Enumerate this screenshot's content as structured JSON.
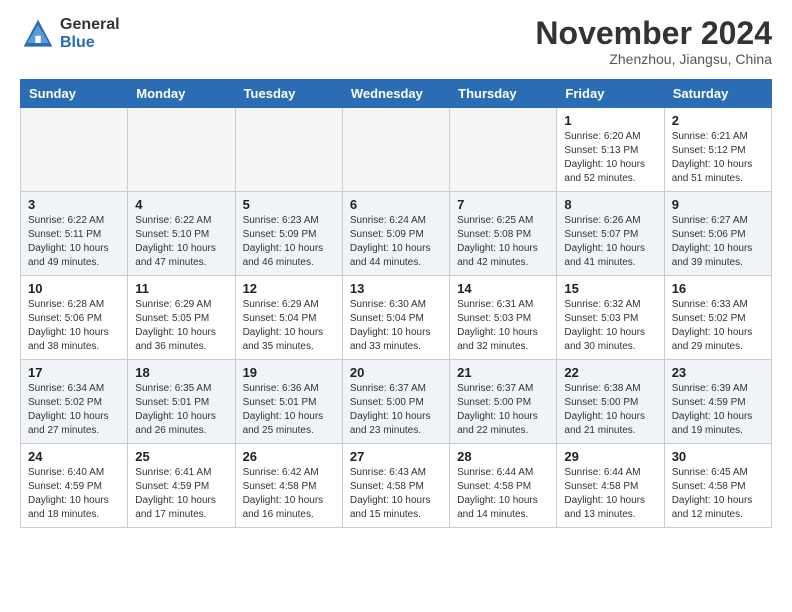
{
  "logo": {
    "general": "General",
    "blue": "Blue"
  },
  "header": {
    "month": "November 2024",
    "location": "Zhenzhou, Jiangsu, China"
  },
  "weekdays": [
    "Sunday",
    "Monday",
    "Tuesday",
    "Wednesday",
    "Thursday",
    "Friday",
    "Saturday"
  ],
  "weeks": [
    [
      {
        "day": "",
        "info": ""
      },
      {
        "day": "",
        "info": ""
      },
      {
        "day": "",
        "info": ""
      },
      {
        "day": "",
        "info": ""
      },
      {
        "day": "",
        "info": ""
      },
      {
        "day": "1",
        "info": "Sunrise: 6:20 AM\nSunset: 5:13 PM\nDaylight: 10 hours\nand 52 minutes."
      },
      {
        "day": "2",
        "info": "Sunrise: 6:21 AM\nSunset: 5:12 PM\nDaylight: 10 hours\nand 51 minutes."
      }
    ],
    [
      {
        "day": "3",
        "info": "Sunrise: 6:22 AM\nSunset: 5:11 PM\nDaylight: 10 hours\nand 49 minutes."
      },
      {
        "day": "4",
        "info": "Sunrise: 6:22 AM\nSunset: 5:10 PM\nDaylight: 10 hours\nand 47 minutes."
      },
      {
        "day": "5",
        "info": "Sunrise: 6:23 AM\nSunset: 5:09 PM\nDaylight: 10 hours\nand 46 minutes."
      },
      {
        "day": "6",
        "info": "Sunrise: 6:24 AM\nSunset: 5:09 PM\nDaylight: 10 hours\nand 44 minutes."
      },
      {
        "day": "7",
        "info": "Sunrise: 6:25 AM\nSunset: 5:08 PM\nDaylight: 10 hours\nand 42 minutes."
      },
      {
        "day": "8",
        "info": "Sunrise: 6:26 AM\nSunset: 5:07 PM\nDaylight: 10 hours\nand 41 minutes."
      },
      {
        "day": "9",
        "info": "Sunrise: 6:27 AM\nSunset: 5:06 PM\nDaylight: 10 hours\nand 39 minutes."
      }
    ],
    [
      {
        "day": "10",
        "info": "Sunrise: 6:28 AM\nSunset: 5:06 PM\nDaylight: 10 hours\nand 38 minutes."
      },
      {
        "day": "11",
        "info": "Sunrise: 6:29 AM\nSunset: 5:05 PM\nDaylight: 10 hours\nand 36 minutes."
      },
      {
        "day": "12",
        "info": "Sunrise: 6:29 AM\nSunset: 5:04 PM\nDaylight: 10 hours\nand 35 minutes."
      },
      {
        "day": "13",
        "info": "Sunrise: 6:30 AM\nSunset: 5:04 PM\nDaylight: 10 hours\nand 33 minutes."
      },
      {
        "day": "14",
        "info": "Sunrise: 6:31 AM\nSunset: 5:03 PM\nDaylight: 10 hours\nand 32 minutes."
      },
      {
        "day": "15",
        "info": "Sunrise: 6:32 AM\nSunset: 5:03 PM\nDaylight: 10 hours\nand 30 minutes."
      },
      {
        "day": "16",
        "info": "Sunrise: 6:33 AM\nSunset: 5:02 PM\nDaylight: 10 hours\nand 29 minutes."
      }
    ],
    [
      {
        "day": "17",
        "info": "Sunrise: 6:34 AM\nSunset: 5:02 PM\nDaylight: 10 hours\nand 27 minutes."
      },
      {
        "day": "18",
        "info": "Sunrise: 6:35 AM\nSunset: 5:01 PM\nDaylight: 10 hours\nand 26 minutes."
      },
      {
        "day": "19",
        "info": "Sunrise: 6:36 AM\nSunset: 5:01 PM\nDaylight: 10 hours\nand 25 minutes."
      },
      {
        "day": "20",
        "info": "Sunrise: 6:37 AM\nSunset: 5:00 PM\nDaylight: 10 hours\nand 23 minutes."
      },
      {
        "day": "21",
        "info": "Sunrise: 6:37 AM\nSunset: 5:00 PM\nDaylight: 10 hours\nand 22 minutes."
      },
      {
        "day": "22",
        "info": "Sunrise: 6:38 AM\nSunset: 5:00 PM\nDaylight: 10 hours\nand 21 minutes."
      },
      {
        "day": "23",
        "info": "Sunrise: 6:39 AM\nSunset: 4:59 PM\nDaylight: 10 hours\nand 19 minutes."
      }
    ],
    [
      {
        "day": "24",
        "info": "Sunrise: 6:40 AM\nSunset: 4:59 PM\nDaylight: 10 hours\nand 18 minutes."
      },
      {
        "day": "25",
        "info": "Sunrise: 6:41 AM\nSunset: 4:59 PM\nDaylight: 10 hours\nand 17 minutes."
      },
      {
        "day": "26",
        "info": "Sunrise: 6:42 AM\nSunset: 4:58 PM\nDaylight: 10 hours\nand 16 minutes."
      },
      {
        "day": "27",
        "info": "Sunrise: 6:43 AM\nSunset: 4:58 PM\nDaylight: 10 hours\nand 15 minutes."
      },
      {
        "day": "28",
        "info": "Sunrise: 6:44 AM\nSunset: 4:58 PM\nDaylight: 10 hours\nand 14 minutes."
      },
      {
        "day": "29",
        "info": "Sunrise: 6:44 AM\nSunset: 4:58 PM\nDaylight: 10 hours\nand 13 minutes."
      },
      {
        "day": "30",
        "info": "Sunrise: 6:45 AM\nSunset: 4:58 PM\nDaylight: 10 hours\nand 12 minutes."
      }
    ]
  ]
}
